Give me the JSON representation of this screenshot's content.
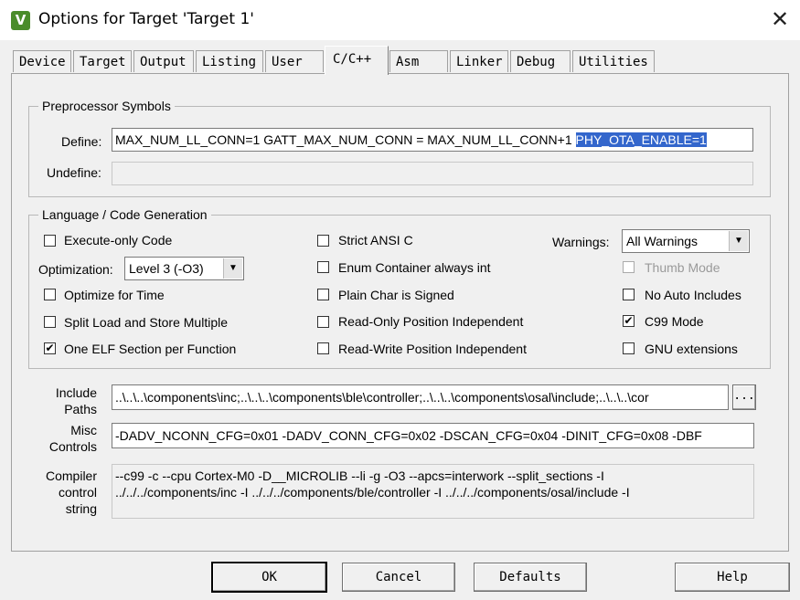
{
  "window": {
    "title": "Options for Target 'Target 1'",
    "icon": "uvision-icon"
  },
  "tabs": [
    {
      "label": "Device"
    },
    {
      "label": "Target"
    },
    {
      "label": "Output"
    },
    {
      "label": "Listing"
    },
    {
      "label": "User"
    },
    {
      "label": "C/C++"
    },
    {
      "label": "Asm"
    },
    {
      "label": "Linker"
    },
    {
      "label": "Debug"
    },
    {
      "label": "Utilities"
    }
  ],
  "active_tab": "C/C++",
  "preprocessor": {
    "group_label": "Preprocessor Symbols",
    "define_label": "Define:",
    "define_value_plain": "MAX_NUM_LL_CONN=1 GATT_MAX_NUM_CONN = MAX_NUM_LL_CONN+1 ",
    "define_value_selected": "PHY_OTA_ENABLE=1",
    "undefine_label": "Undefine:",
    "undefine_value": ""
  },
  "language": {
    "group_label": "Language / Code Generation",
    "execute_only": {
      "label": "Execute-only Code",
      "checked": false
    },
    "optimization_label": "Optimization:",
    "optimization_value": "Level 3 (-O3)",
    "optimize_time": {
      "label": "Optimize for Time",
      "checked": false
    },
    "split_load": {
      "label": "Split Load and Store Multiple",
      "checked": false
    },
    "one_elf": {
      "label": "One ELF Section per Function",
      "checked": true
    },
    "strict_ansi": {
      "label": "Strict ANSI C",
      "checked": false
    },
    "enum_container": {
      "label": "Enum Container always int",
      "checked": false
    },
    "plain_char": {
      "label": "Plain Char is Signed",
      "checked": false
    },
    "ro_position": {
      "label": "Read-Only Position Independent",
      "checked": false
    },
    "rw_position": {
      "label": "Read-Write Position Independent",
      "checked": false
    },
    "warnings_label": "Warnings:",
    "warnings_value": "All Warnings",
    "thumb_mode": {
      "label": "Thumb Mode",
      "checked": false,
      "disabled": true
    },
    "no_auto_includes": {
      "label": "No Auto Includes",
      "checked": false
    },
    "c99_mode": {
      "label": "C99 Mode",
      "checked": true
    },
    "gnu_extensions": {
      "label": "GNU extensions",
      "checked": false
    }
  },
  "include": {
    "label_line1": "Include",
    "label_line2": "Paths",
    "value": "..\\..\\..\\components\\inc;..\\..\\..\\components\\ble\\controller;..\\..\\..\\components\\osal\\include;..\\..\\..\\cor",
    "browse_label": "..."
  },
  "misc": {
    "label_line1": "Misc",
    "label_line2": "Controls",
    "value": "-DADV_NCONN_CFG=0x01  -DADV_CONN_CFG=0x02  -DSCAN_CFG=0x04  -DINIT_CFG=0x08  -DBF"
  },
  "compiler": {
    "label_line1": "Compiler",
    "label_line2": "control",
    "label_line3": "string",
    "line1": "--c99 -c --cpu Cortex-M0 -D__MICROLIB --li -g -O3 --apcs=interwork --split_sections -I",
    "line2": "../../../components/inc -I ../../../components/ble/controller -I ../../../components/osal/include -I"
  },
  "buttons": {
    "ok": "OK",
    "cancel": "Cancel",
    "defaults": "Defaults",
    "help": "Help"
  },
  "check_glyph": "✔",
  "dropdown_glyph": "▼",
  "close_glyph": "✕",
  "logo_glyph": "V"
}
